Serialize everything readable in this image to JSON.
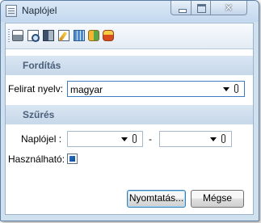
{
  "window": {
    "title": "Naplójel",
    "close_glyph": "✕"
  },
  "toolbar": {
    "icons": [
      "print-icon",
      "print-preview-icon",
      "export-icon",
      "edit-icon",
      "calculator-icon",
      "database-icon",
      "database-refresh-icon"
    ]
  },
  "sections": {
    "translation_header": "Fordítás",
    "filter_header": "Szűrés"
  },
  "translation": {
    "label": "Felirat nyelv:",
    "value": "magyar"
  },
  "filter": {
    "log_label": "Naplójel :",
    "from_value": "",
    "separator": "-",
    "to_value": "",
    "usable_label": "Használható:",
    "usable_checked": true
  },
  "buttons": {
    "print": "Nyomtatás...",
    "cancel": "Mégse"
  },
  "colors": {
    "window_frame": "#cfe0ef",
    "section_header_text": "#4a5f7a",
    "focus_border": "#3d7bc0"
  }
}
